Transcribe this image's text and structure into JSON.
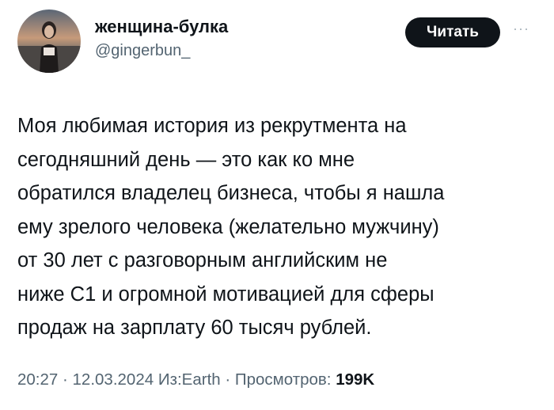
{
  "author": {
    "display_name": "женщина-булка",
    "handle": "@gingerbun_"
  },
  "follow_button": {
    "label": "Читать"
  },
  "more_icon": {
    "icon": "more-horizontal-icon",
    "glyph": "···"
  },
  "tweet": {
    "lines": [
      "Моя любимая история из рекрутмента на",
      "сегодняшний день — это как ко мне",
      "обратился владелец бизнеса, чтобы я нашла",
      "ему зрелого человека (желательно мужчину)",
      "от 30 лет с разговорным английским не",
      "ниже C1 и огромной мотивацией для сферы",
      "продаж на зарплату 60 тысяч рублей."
    ]
  },
  "meta": {
    "time": "20:27",
    "sep1": " · ",
    "date": "12.03.2024",
    "source": "Из:Earth",
    "sep2": " · ",
    "views_label": "Просмотров:",
    "views_count": "199K"
  },
  "colors": {
    "text": "#0f1419",
    "secondary": "#536471",
    "button_bg": "#0f1419",
    "button_text": "#ffffff"
  }
}
